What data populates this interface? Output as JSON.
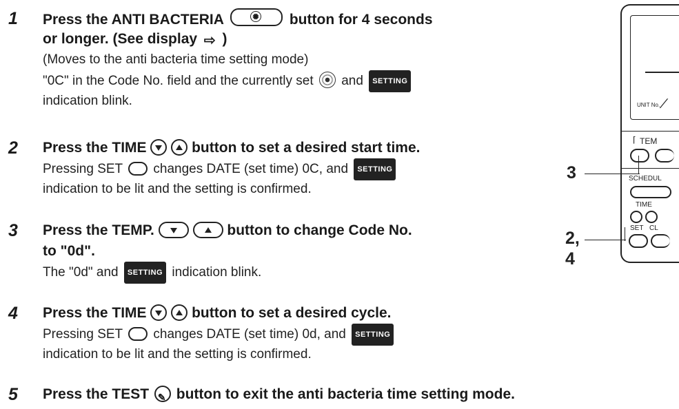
{
  "steps": [
    {
      "num": "1",
      "head1_a": "Press the ANTI BACTERIA",
      "head1_b": "button for 4 seconds",
      "head2_a": "or longer. (See display",
      "head2_b": ")",
      "body1": "(Moves to the anti bacteria time setting mode)",
      "body2_a": "\"0C\" in the Code No. field and the currently set",
      "body2_b": "and",
      "body3": "indication blink."
    },
    {
      "num": "2",
      "head_a": "Press the TIME",
      "head_b": "button to set a desired start time.",
      "body1_a": "Pressing SET",
      "body1_b": "changes DATE (set time) 0C, and",
      "body2": "indication to be lit and the setting is confirmed."
    },
    {
      "num": "3",
      "head_a": "Press the TEMP.",
      "head_b": "button to change Code No.",
      "head2": "to \"0d\".",
      "body_a": "The \"0d\" and",
      "body_b": "indication blink."
    },
    {
      "num": "4",
      "head_a": "Press the TIME",
      "head_b": "button to set a desired cycle.",
      "body1_a": "Pressing SET",
      "body1_b": "changes DATE (set time) 0d, and",
      "body2": "indication to be lit and the setting is confirmed."
    },
    {
      "num": "5",
      "head_a": "Press the TEST",
      "head_b": "button to exit the anti bacteria time setting mode."
    }
  ],
  "badge_text": "SETTING",
  "icons": {
    "anti_bacteria": "anti-bacteria-icon",
    "display_arrow": "arrow-right-icon",
    "down": "down-arrow-icon",
    "up": "up-arrow-icon",
    "set": "set-button-icon",
    "test": "wrench-icon"
  },
  "remote": {
    "unit_no": "UNIT No.",
    "temp": "TEM",
    "schedule": "SCHEDUL",
    "time": "TIME",
    "set": "SET",
    "cl": "CL",
    "callout_3": "3",
    "callout_24a": "2,",
    "callout_24b": "4"
  }
}
